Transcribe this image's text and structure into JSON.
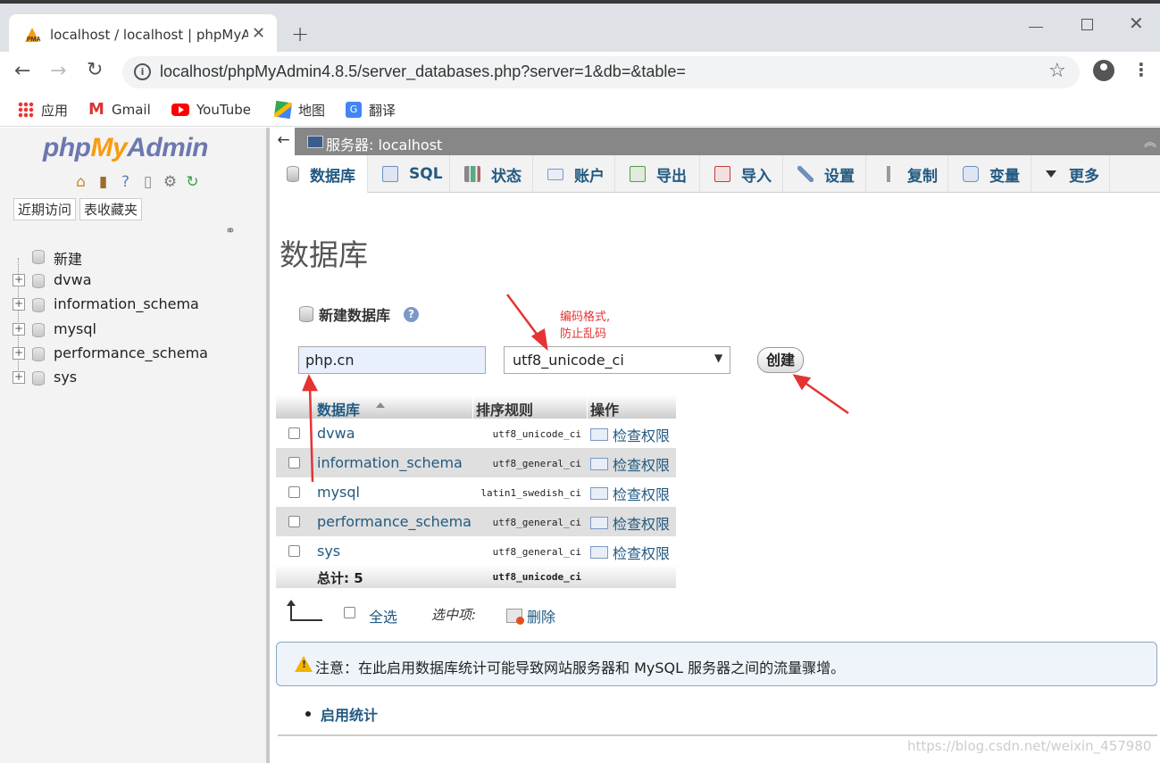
{
  "browser": {
    "tab_title": "localhost / localhost | phpMyA",
    "new_tab": "+",
    "url": "localhost/phpMyAdmin4.8.5/server_databases.php?server=1&db=&table=",
    "bookmarks": [
      {
        "label": "应用",
        "icon": "apps-grid-icon"
      },
      {
        "label": "Gmail",
        "icon": "gmail-icon"
      },
      {
        "label": "YouTube",
        "icon": "youtube-icon"
      },
      {
        "label": "地图",
        "icon": "maps-icon"
      },
      {
        "label": "翻译",
        "icon": "translate-icon"
      }
    ]
  },
  "sidebar": {
    "logo": {
      "php": "php",
      "my": "My",
      "admin": "Admin"
    },
    "tabs": [
      "近期访问",
      "表收藏夹"
    ],
    "tree": [
      {
        "label": "新建",
        "expandable": false
      },
      {
        "label": "dvwa",
        "expandable": true
      },
      {
        "label": "information_schema",
        "expandable": true
      },
      {
        "label": "mysql",
        "expandable": true
      },
      {
        "label": "performance_schema",
        "expandable": true
      },
      {
        "label": "sys",
        "expandable": true
      }
    ]
  },
  "server_bar": {
    "label": "服务器: localhost"
  },
  "main_tabs": [
    {
      "label": "数据库",
      "active": true,
      "icon": "database-icon"
    },
    {
      "label": "SQL",
      "active": false,
      "icon": "sql-icon"
    },
    {
      "label": "状态",
      "active": false,
      "icon": "status-icon"
    },
    {
      "label": "账户",
      "active": false,
      "icon": "accounts-icon"
    },
    {
      "label": "导出",
      "active": false,
      "icon": "export-icon"
    },
    {
      "label": "导入",
      "active": false,
      "icon": "import-icon"
    },
    {
      "label": "设置",
      "active": false,
      "icon": "settings-icon"
    },
    {
      "label": "复制",
      "active": false,
      "icon": "replication-icon"
    },
    {
      "label": "变量",
      "active": false,
      "icon": "variables-icon"
    },
    {
      "label": "更多",
      "active": false,
      "icon": "more-icon"
    }
  ],
  "page": {
    "title": "数据库",
    "create_section": {
      "heading": "新建数据库",
      "name_value": "php.cn",
      "collation_value": "utf8_unicode_ci",
      "create_label": "创建"
    },
    "annotation": {
      "line1": "编码格式,",
      "line2": "防止乱码"
    },
    "table": {
      "headers": {
        "database": "数据库",
        "collation": "排序规则",
        "action": "操作"
      },
      "rows": [
        {
          "name": "dvwa",
          "collation": "utf8_unicode_ci",
          "action": "检查权限"
        },
        {
          "name": "information_schema",
          "collation": "utf8_general_ci",
          "action": "检查权限"
        },
        {
          "name": "mysql",
          "collation": "latin1_swedish_ci",
          "action": "检查权限"
        },
        {
          "name": "performance_schema",
          "collation": "utf8_general_ci",
          "action": "检查权限"
        },
        {
          "name": "sys",
          "collation": "utf8_general_ci",
          "action": "检查权限"
        }
      ],
      "footer": {
        "total": "总计: 5",
        "collation": "utf8_unicode_ci"
      }
    },
    "bulk": {
      "select_all": "全选",
      "with_selected": "选中项:",
      "delete": "删除"
    },
    "notice": "注意：在此启用数据库统计可能导致网站服务器和 MySQL 服务器之间的流量骤增。",
    "enable_stats": "启用统计"
  },
  "watermark": "https://blog.csdn.net/weixin_457980"
}
